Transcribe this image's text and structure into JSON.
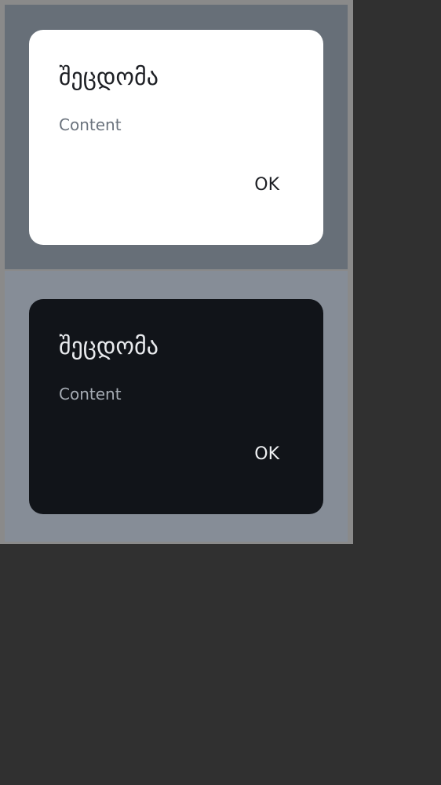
{
  "colors": {
    "screen_background": "#303030",
    "frame": "#8a8a8a",
    "light_scrim": "#676f78",
    "dark_scrim": "#868d97",
    "light_dialog": "#ffffff",
    "dark_dialog": "#111419"
  },
  "light_dialog": {
    "title": "შეცდომა",
    "content": "Content",
    "ok_label": "OK"
  },
  "dark_dialog": {
    "title": "შეცდომა",
    "content": "Content",
    "ok_label": "OK"
  }
}
